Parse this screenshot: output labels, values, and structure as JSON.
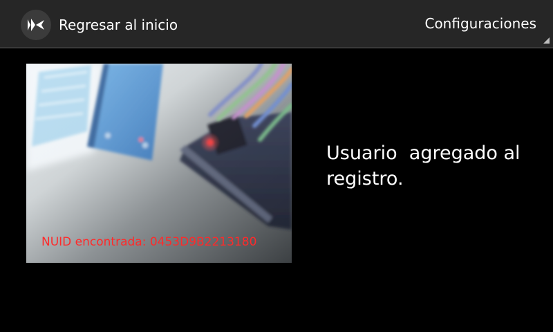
{
  "action_bar": {
    "title": "Regresar al inicio",
    "app_icon": "kivy-logo-icon",
    "settings_label": "Configuraciones",
    "overflow_icon": "overflow-corner-icon"
  },
  "camera": {
    "nuid_text": "NUID encontrada: 0453D9B2213180",
    "overlay_color": "#ff2a2a"
  },
  "message": {
    "text": "Usuario  agregado al\nregistro."
  },
  "colors": {
    "action_bar_bg": "#262626",
    "background": "#000000",
    "text": "#ffffff"
  }
}
